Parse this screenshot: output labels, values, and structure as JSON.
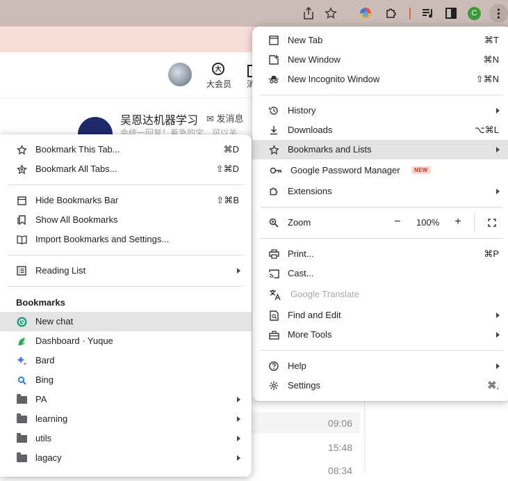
{
  "chrome": {
    "share_icon": "share-icon",
    "star_icon": "star-icon",
    "extension_icons": [
      "colorful-extension-icon",
      "puzzle-icon",
      "media-icon",
      "sidepanel-icon"
    ],
    "profile_initial": "C",
    "menu_icon": "kebab-icon",
    "colors": {
      "toolbar": "#cbbcb7",
      "tabstrip": "#f7dcd4",
      "profile": "#3f9a3c"
    }
  },
  "page": {
    "header_vip": "大会员",
    "header_msg": "消",
    "title": "吴恩达机器学习",
    "send_message": "发消息",
    "subtitle": "会统一回复！着急的宝，可以关",
    "chat_times": [
      "09:06",
      "15:48",
      "08:34"
    ]
  },
  "main_menu": {
    "items": [
      {
        "label": "New Tab",
        "shortcut": "⌘T"
      },
      {
        "label": "New Window",
        "shortcut": "⌘N"
      },
      {
        "label": "New Incognito Window",
        "shortcut": "⇧⌘N"
      },
      {
        "label": "History",
        "shortcut": ""
      },
      {
        "label": "Downloads",
        "shortcut": "⌥⌘L"
      },
      {
        "label": "Bookmarks and Lists",
        "shortcut": ""
      },
      {
        "label": "Google Password Manager",
        "shortcut": "",
        "badge": "NEW"
      },
      {
        "label": "Extensions",
        "shortcut": ""
      },
      {
        "label": "Zoom",
        "shortcut": ""
      },
      {
        "label": "Print...",
        "shortcut": "⌘P"
      },
      {
        "label": "Cast...",
        "shortcut": ""
      },
      {
        "label": "Google Translate",
        "shortcut": ""
      },
      {
        "label": "Find and Edit",
        "shortcut": ""
      },
      {
        "label": "More Tools",
        "shortcut": ""
      },
      {
        "label": "Help",
        "shortcut": ""
      },
      {
        "label": "Settings",
        "shortcut": "⌘,"
      }
    ],
    "zoom": {
      "minus": "−",
      "value": "100%",
      "plus": "+"
    }
  },
  "bookmarks_menu": {
    "items": [
      {
        "label": "Bookmark This Tab...",
        "shortcut": "⌘D"
      },
      {
        "label": "Bookmark All Tabs...",
        "shortcut": "⇧⌘D"
      },
      {
        "label": "Hide Bookmarks Bar",
        "shortcut": "⇧⌘B"
      },
      {
        "label": "Show All Bookmarks",
        "shortcut": ""
      },
      {
        "label": "Import Bookmarks and Settings...",
        "shortcut": ""
      },
      {
        "label": "Reading List",
        "shortcut": ""
      }
    ],
    "section_title": "Bookmarks",
    "bookmarks": [
      {
        "label": "New chat",
        "icon": "chatgpt-icon"
      },
      {
        "label": "Dashboard · Yuque",
        "icon": "yuque-icon"
      },
      {
        "label": "Bard",
        "icon": "bard-icon"
      },
      {
        "label": "Bing",
        "icon": "bing-icon"
      },
      {
        "label": "PA",
        "icon": "folder-icon"
      },
      {
        "label": "learning",
        "icon": "folder-icon"
      },
      {
        "label": "utils",
        "icon": "folder-icon"
      },
      {
        "label": "lagacy",
        "icon": "folder-icon"
      }
    ]
  }
}
